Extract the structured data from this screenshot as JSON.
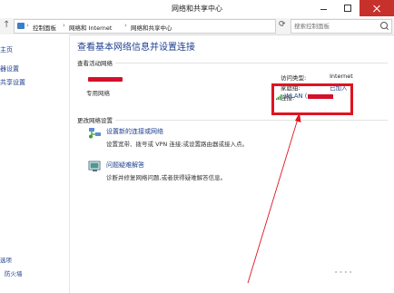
{
  "window": {
    "title": "网络和共享中心"
  },
  "address": {
    "crumbs": [
      "控制面板",
      "网络和 Internet",
      "网络和共享中心"
    ],
    "search_placeholder": "搜索控制面板"
  },
  "left_pane": {
    "items": [
      "主页",
      "器设置",
      "共享设置"
    ],
    "see_also": [
      "选项",
      "防火墙"
    ]
  },
  "main": {
    "heading": "查看基本网络信息并设置连接",
    "active_networks_label": "查看活动网络",
    "network_type": "专用网络",
    "access_type_label": "访问类型:",
    "access_type_value": "Internet",
    "homegroup_label": "家庭组:",
    "homegroup_value": "已加入",
    "connection_label": "连接:",
    "connection_value": "WLAN (",
    "change_settings_label": "更改网络设置",
    "tasks": [
      {
        "link": "设置新的连接或网络",
        "desc": "设置宽带、拨号或 VPN 连接;或设置路由器或接入点。",
        "icon": "network-setup-icon"
      },
      {
        "link": "问题疑难解答",
        "desc": "诊断并修复网络问题,或者获得疑难解答信息。",
        "icon": "troubleshoot-icon"
      }
    ]
  },
  "colors": {
    "link": "#1e3f8f",
    "highlight": "#e01320",
    "redaction": "#d4102a",
    "close_button": "#c7312b"
  }
}
